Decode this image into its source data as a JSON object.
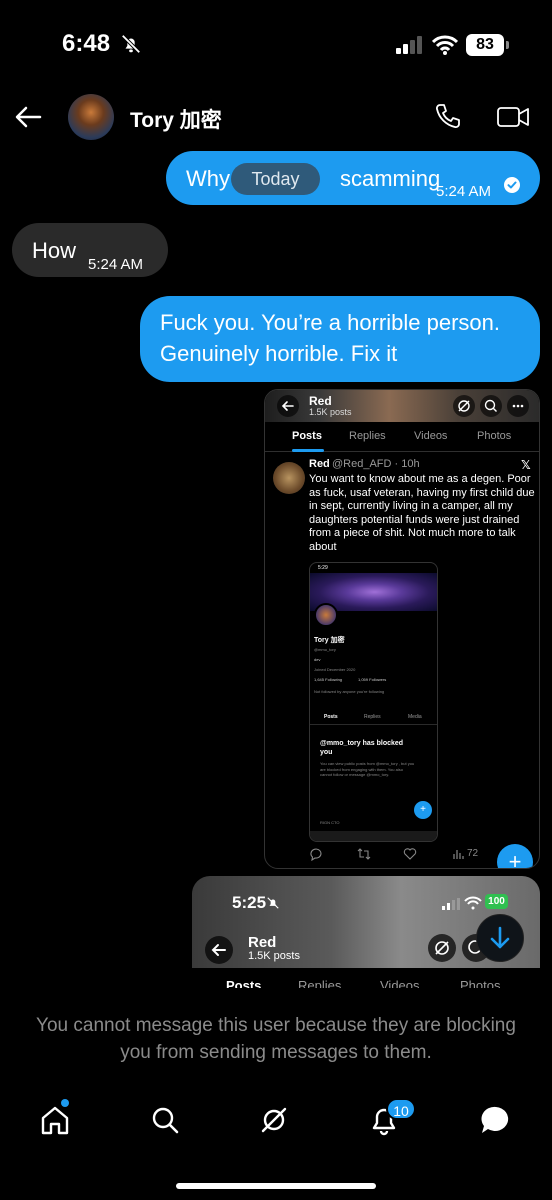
{
  "status_bar": {
    "time": "6:48",
    "battery": "83"
  },
  "header": {
    "contact_name": "Tory 加密"
  },
  "messages": [
    {
      "direction": "outgoing",
      "text": "Why",
      "text_after": "scamming",
      "time": "5:24 AM",
      "read": true
    },
    {
      "direction": "incoming",
      "text": "How",
      "time": "5:24 AM"
    },
    {
      "direction": "outgoing",
      "text": "Fuck you. You’re a horrible person. Genuinely horrible. Fix it"
    }
  ],
  "date_chip": "Today",
  "shared_post": {
    "profile_name": "Red",
    "profile_posts": "1.5K posts",
    "tabs": [
      "Posts",
      "Replies",
      "Videos",
      "Photos"
    ],
    "author": "Red",
    "handle_time": "@Red_AFD · 10h",
    "text": "You want to know about me as a degen. Poor as fuck, usaf veteran, having my first child due in sept, currently living in a camper, all my daughters potential funds were just drained from a piece of shit. Not much more to talk about",
    "views": "72",
    "nested": {
      "time": "5:29",
      "name": "Tory 加密",
      "handle": "@mmo_tory",
      "bio": "dev",
      "joined": "Joined December 2020",
      "following": "1,645 Following",
      "followers": "1,059 Followers",
      "followed_note": "Not followed by anyone you're following",
      "tabs": [
        "Posts",
        "Replies",
        "Media"
      ],
      "blocked_title": "@mmo_tory has blocked you",
      "blocked_desc": "You can view public posts from @mmo_tory , but you are blocked from engaging with them. You also cannot follow or message @mmo_tory.",
      "footer": "RIGN CTO"
    }
  },
  "shared_post_2": {
    "time": "5:25",
    "battery": "100",
    "profile_name": "Red",
    "profile_posts": "1.5K posts",
    "tabs": [
      "Posts",
      "Replies",
      "Videos",
      "Photos"
    ]
  },
  "blocked_notice": "You cannot message this user because they are blocking you from sending messages to them.",
  "nav": {
    "notification_count": "10"
  },
  "colors": {
    "accent": "#1d9bf0",
    "incoming_bubble": "#2a2a2a",
    "background": "#000000"
  }
}
